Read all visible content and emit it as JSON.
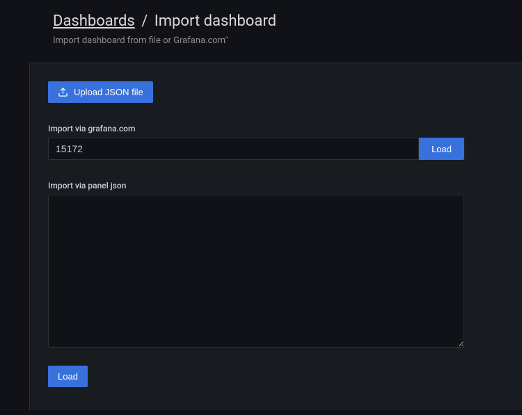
{
  "header": {
    "breadcrumb_root": "Dashboards",
    "breadcrumb_sep": "/",
    "breadcrumb_current": "Import dashboard",
    "subtitle": "Import dashboard from file or Grafana.com\""
  },
  "upload": {
    "button_label": "Upload JSON file"
  },
  "grafana_import": {
    "label": "Import via grafana.com",
    "value": "15172",
    "load_label": "Load"
  },
  "json_import": {
    "label": "Import via panel json",
    "value": "",
    "load_label": "Load"
  }
}
